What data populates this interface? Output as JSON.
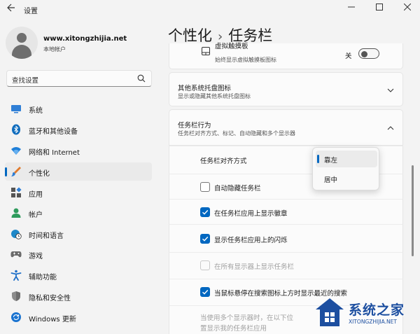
{
  "window": {
    "title": "设置",
    "back_icon": "back-arrow-icon",
    "controls": [
      "minimize-icon",
      "maximize-icon",
      "close-icon"
    ]
  },
  "profile": {
    "name": "www.xitongzhijia.net",
    "account_type": "本地帐户"
  },
  "search": {
    "placeholder": "查找设置"
  },
  "sidebar": {
    "items": [
      {
        "label": "系统",
        "icon": "monitor-icon",
        "active": false
      },
      {
        "label": "蓝牙和其他设备",
        "icon": "bluetooth-icon",
        "active": false
      },
      {
        "label": "网络和 Internet",
        "icon": "wifi-icon",
        "active": false
      },
      {
        "label": "个性化",
        "icon": "brush-icon",
        "active": true
      },
      {
        "label": "应用",
        "icon": "apps-icon",
        "active": false
      },
      {
        "label": "帐户",
        "icon": "person-icon",
        "active": false
      },
      {
        "label": "时间和语言",
        "icon": "globe-clock-icon",
        "active": false
      },
      {
        "label": "游戏",
        "icon": "gamepad-icon",
        "active": false
      },
      {
        "label": "辅助功能",
        "icon": "accessibility-icon",
        "active": false
      },
      {
        "label": "隐私和安全性",
        "icon": "shield-icon",
        "active": false
      },
      {
        "label": "Windows 更新",
        "icon": "update-icon",
        "active": false
      }
    ]
  },
  "header": {
    "parent": "个性化",
    "separator": "›",
    "current": "任务栏"
  },
  "touchpad_card": {
    "title": "虚拟触摸板",
    "subtitle": "始终显示虚拟触摸板图标",
    "toggle_label": "关",
    "toggle_on": false
  },
  "tray_card": {
    "title": "其他系统托盘图标",
    "subtitle": "显示或隐藏其他系统托盘图标"
  },
  "behavior_card": {
    "title": "任务栏行为",
    "subtitle": "任务栏对齐方式、标记、自动隐藏和多个显示器"
  },
  "alignment": {
    "label": "任务栏对齐方式",
    "options": [
      "靠左",
      "居中"
    ],
    "selected": "靠左"
  },
  "behaviors": [
    {
      "label": "自动隐藏任务栏",
      "checked": false,
      "enabled": true
    },
    {
      "label": "在任务栏应用上显示徽章",
      "checked": true,
      "enabled": true
    },
    {
      "label": "显示任务栏应用上的闪烁",
      "checked": true,
      "enabled": true
    },
    {
      "label": "在所有显示器上显示任务栏",
      "checked": false,
      "enabled": false
    },
    {
      "label": "当鼠标悬停在搜索图标上方时显示最近的搜索",
      "checked": true,
      "enabled": true
    }
  ],
  "multi_display_note": {
    "line1": "当使用多个显示器时，在以下位",
    "line2": "置显示我的任务栏应用"
  },
  "watermark": {
    "brand": "系统之家",
    "url": "XITONGZHIJIA.NET"
  },
  "colors": {
    "accent": "#0067c0",
    "background": "#f3f3f3",
    "card": "#fbfbfb"
  }
}
